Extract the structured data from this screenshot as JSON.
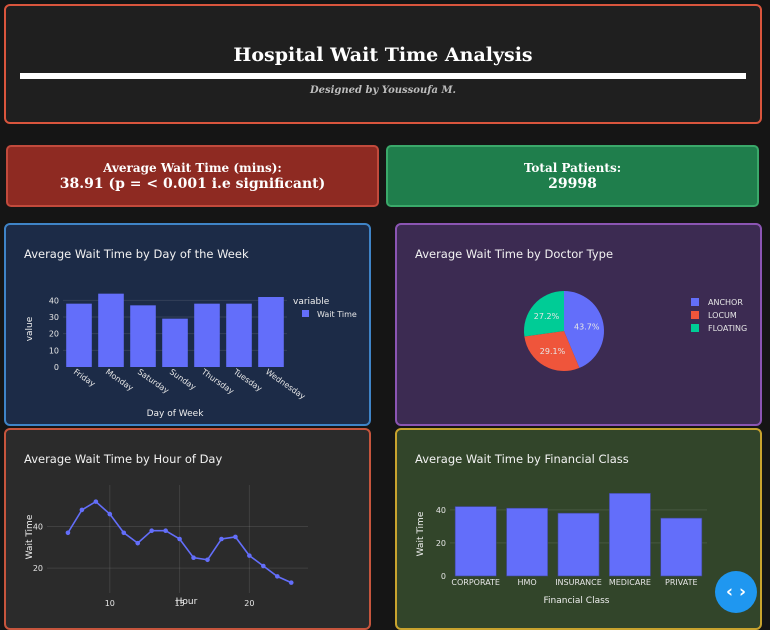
{
  "header": {
    "title": "Hospital Wait Time Analysis",
    "credit": "Designed by Youssoufa M."
  },
  "kpis": {
    "wait_label": "Average Wait Time (mins):",
    "wait_value": "38.91 (p = < 0.001 i.e significant)",
    "patients_label": "Total Patients:",
    "patients_value": "29998"
  },
  "nav": {
    "icon": "code-arrows-icon",
    "glyph": "‹ ›"
  },
  "chart_data": [
    {
      "type": "bar",
      "title": "Average Wait Time by Day of the Week",
      "xlabel": "Day of Week",
      "ylabel": "value",
      "categories": [
        "Friday",
        "Monday",
        "Saturday",
        "Sunday",
        "Thursday",
        "Tuesday",
        "Wednesday"
      ],
      "series": [
        {
          "name": "Wait Time",
          "values": [
            38,
            44,
            37,
            29,
            38,
            38,
            42
          ]
        }
      ],
      "legend_title": "variable",
      "legend_position": "top-right",
      "ylim": [
        0,
        45
      ],
      "yticks": [
        0,
        10,
        20,
        30,
        40
      ],
      "color": "#636efa"
    },
    {
      "type": "pie",
      "title": "Average Wait Time by Doctor Type",
      "labels": [
        "ANCHOR",
        "LOCUM",
        "FLOATING"
      ],
      "values": [
        43.7,
        29.1,
        27.2
      ],
      "value_labels": [
        "43.7%",
        "29.1%",
        "27.2%"
      ],
      "colors": [
        "#636efa",
        "#ef553b",
        "#00cc96"
      ],
      "legend_position": "right"
    },
    {
      "type": "line",
      "title": "Average Wait Time by Hour of Day",
      "xlabel": "Hour",
      "ylabel": "Wait Time",
      "x": [
        7,
        8,
        9,
        10,
        11,
        12,
        13,
        14,
        15,
        16,
        17,
        18,
        19,
        20,
        21,
        22,
        23
      ],
      "series": [
        {
          "name": "Wait Time",
          "values": [
            37,
            48,
            52,
            46,
            37,
            32,
            38,
            38,
            34,
            25,
            24,
            34,
            35,
            26,
            21,
            16,
            13
          ]
        }
      ],
      "xticks": [
        10,
        15,
        20
      ],
      "yticks": [
        20,
        40
      ],
      "xlim": [
        5.5,
        24.2
      ],
      "ylim": [
        8,
        60
      ],
      "color": "#636efa"
    },
    {
      "type": "bar",
      "title": "Average Wait Time by Financial Class",
      "xlabel": "Financial Class",
      "ylabel": "Wait Time",
      "categories": [
        "CORPORATE",
        "HMO",
        "INSURANCE",
        "MEDICARE",
        "PRIVATE"
      ],
      "series": [
        {
          "name": "Wait Time",
          "values": [
            42,
            41,
            38,
            50,
            35
          ]
        }
      ],
      "ylim": [
        0,
        52
      ],
      "yticks": [
        0,
        20,
        40
      ],
      "color": "#636efa"
    }
  ]
}
